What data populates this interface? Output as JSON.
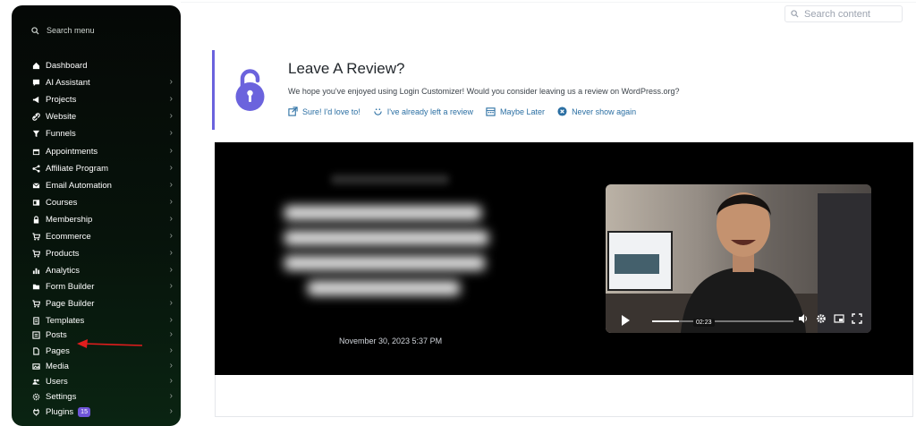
{
  "sidebar": {
    "search_placeholder": "Search menu",
    "items": [
      {
        "label": "Dashboard",
        "icon": "home-icon",
        "chevron": false
      },
      {
        "label": "AI Assistant",
        "icon": "chat-icon",
        "chevron": true
      },
      {
        "label": "Projects",
        "icon": "megaphone-icon",
        "chevron": true
      },
      {
        "label": "Website",
        "icon": "link-icon",
        "chevron": true
      },
      {
        "label": "Funnels",
        "icon": "funnel-icon",
        "chevron": true
      },
      {
        "label": "Appointments",
        "icon": "calendar-icon",
        "chevron": true
      },
      {
        "label": "Affiliate Program",
        "icon": "share-icon",
        "chevron": true
      },
      {
        "label": "Email Automation",
        "icon": "mail-icon",
        "chevron": true
      },
      {
        "label": "Courses",
        "icon": "course-icon",
        "chevron": true
      },
      {
        "label": "Membership",
        "icon": "lock-icon",
        "chevron": true
      },
      {
        "label": "Ecommerce",
        "icon": "cart-icon",
        "chevron": true
      },
      {
        "label": "Products",
        "icon": "cart-icon",
        "chevron": true
      },
      {
        "label": "Analytics",
        "icon": "chart-icon",
        "chevron": true
      },
      {
        "label": "Form Builder",
        "icon": "folder-icon",
        "chevron": true
      },
      {
        "label": "Page Builder",
        "icon": "cart-icon",
        "chevron": true
      },
      {
        "label": "Templates",
        "icon": "document-icon",
        "chevron": true
      },
      {
        "label": "Posts",
        "icon": "posts-icon",
        "chevron": true
      },
      {
        "label": "Pages",
        "icon": "page-icon",
        "chevron": true
      },
      {
        "label": "Media",
        "icon": "media-icon",
        "chevron": true
      },
      {
        "label": "Users",
        "icon": "users-icon",
        "chevron": true
      },
      {
        "label": "Settings",
        "icon": "settings-icon",
        "chevron": true
      },
      {
        "label": "Plugins",
        "icon": "plugin-icon",
        "chevron": true,
        "badge": "15"
      }
    ]
  },
  "header": {
    "search_placeholder": "Search content"
  },
  "review": {
    "title": "Leave A Review?",
    "description": "We hope you've enjoyed using Login Customizer! Would you consider leaving us a review on WordPress.org?",
    "links": [
      {
        "label": "Sure! I'd love to!",
        "icon": "external-link-icon"
      },
      {
        "label": "I've already left a review",
        "icon": "smile-icon"
      },
      {
        "label": "Maybe Later",
        "icon": "calendar-icon"
      },
      {
        "label": "Never show again",
        "icon": "close-circle-icon"
      }
    ]
  },
  "video": {
    "date": "November 30, 2023 5:37 PM",
    "timestamp": "02:23",
    "progress": 0.19
  },
  "colors": {
    "accent": "#6b63dd",
    "link": "#2b6fa3",
    "sidebar_bg": "#050806",
    "badge": "#6f55d8",
    "arrow": "#e11d1d"
  }
}
